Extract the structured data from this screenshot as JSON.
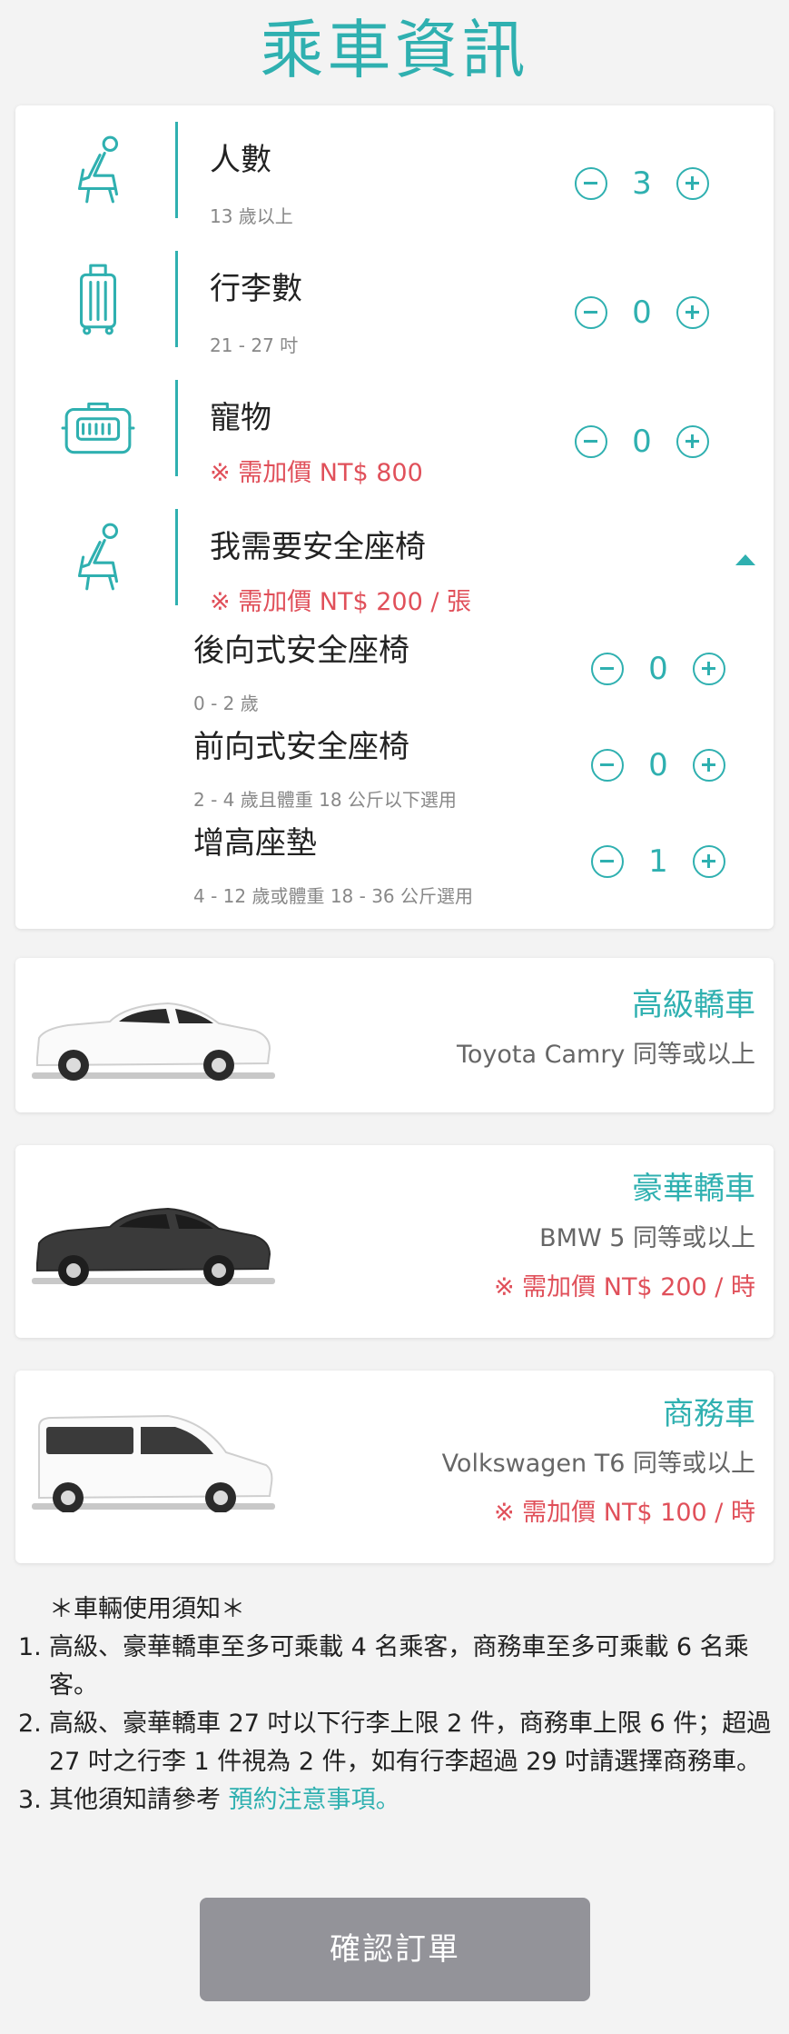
{
  "page": {
    "title": "乘車資訊"
  },
  "passengers": {
    "title": "人數",
    "sub": "13 歲以上",
    "value": "3"
  },
  "luggage": {
    "title": "行李數",
    "sub": "21 - 27 吋",
    "value": "0"
  },
  "pets": {
    "title": "寵物",
    "price": "※ 需加價 NT$ 800",
    "value": "0"
  },
  "child_seat": {
    "title": "我需要安全座椅",
    "price": "※ 需加價 NT$ 200 / 張",
    "rear_facing": {
      "title": "後向式安全座椅",
      "sub": "0 - 2 歲",
      "value": "0"
    },
    "forward_facing": {
      "title": "前向式安全座椅",
      "sub": "2 - 4 歲且體重 18 公斤以下選用",
      "value": "0"
    },
    "booster": {
      "title": "增高座墊",
      "sub": "4 - 12 歲或體重 18 - 36 公斤選用",
      "value": "1"
    }
  },
  "vehicles": {
    "standard": {
      "name": "高級轎車",
      "model": "Toyota Camry 同等或以上",
      "color": "#ffffff"
    },
    "luxury": {
      "name": "豪華轎車",
      "model": "BMW 5 同等或以上",
      "price": "※ 需加價 NT$ 200 / 時",
      "color": "#3a3a3a"
    },
    "van": {
      "name": "商務車",
      "model": "Volkswagen T6 同等或以上",
      "price": "※ 需加價 NT$ 100 / 時",
      "color": "#ffffff"
    }
  },
  "notice": {
    "title": "＊車輛使用須知＊",
    "item1": {
      "num": "1.",
      "text": "高級、豪華轎車至多可乘載 4 名乘客，商務車至多可乘載 6 名乘客。"
    },
    "item2": {
      "num": "2.",
      "text": "高級、豪華轎車 27 吋以下行李上限 2 件，商務車上限 6 件；超過 27 吋之行李 1 件視為 2 件，如有行李超過 29 吋請選擇商務車。"
    },
    "item3": {
      "num": "3.",
      "text": "其他須知請參考 ",
      "link": "預約注意事項。"
    }
  },
  "confirm_button": "確認訂單",
  "colors": {
    "accent": "#2fb0b0",
    "price": "#e0505a",
    "button_disabled": "#939399"
  },
  "icons": {
    "passenger": "seat-passenger-icon",
    "luggage": "suitcase-icon",
    "pet": "pet-carrier-icon",
    "child_seat": "child-seat-icon"
  }
}
